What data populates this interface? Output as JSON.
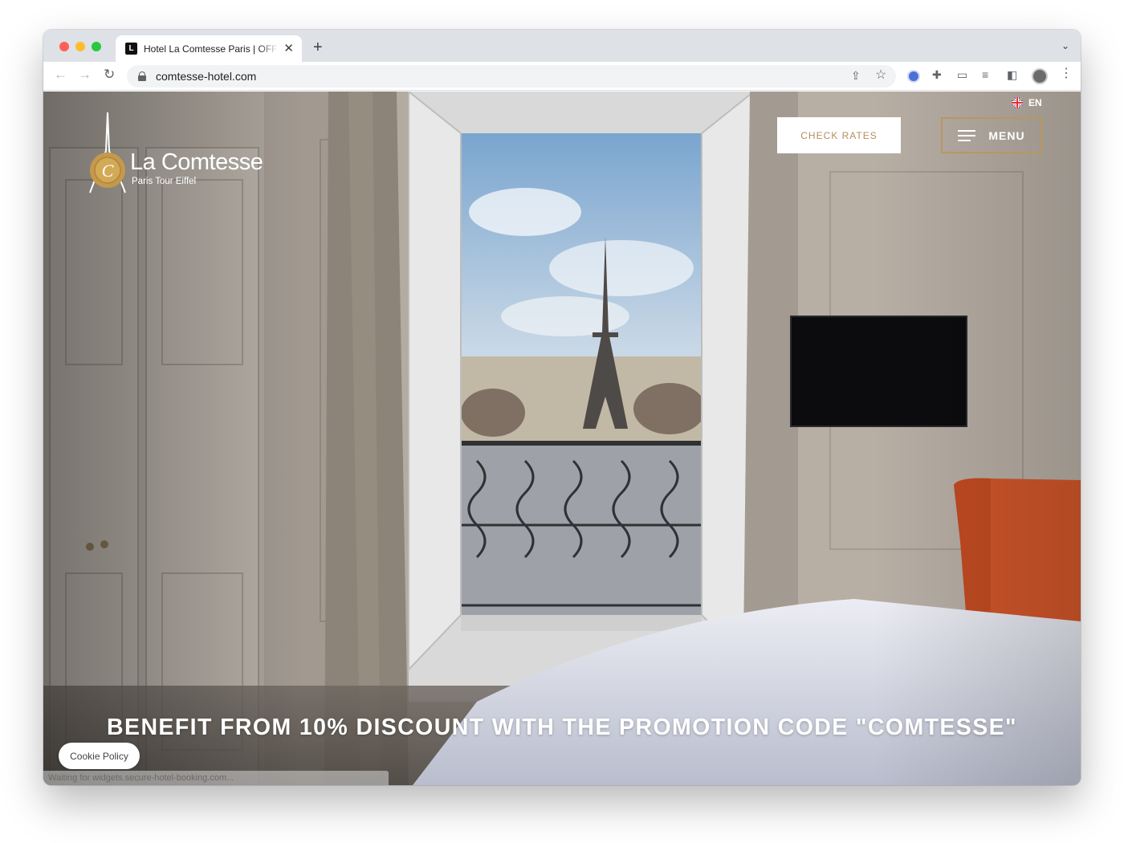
{
  "browser": {
    "tab_title": "Hotel La Comtesse Paris | OFFICIAL SITE",
    "tab_favicon": "L",
    "close_glyph": "✕",
    "new_tab_glyph": "+",
    "tab_menu_glyph": "⌄",
    "url": "comtesse-hotel.com",
    "nav": {
      "back": "←",
      "forward": "→",
      "reload": "↻"
    },
    "toolbar_icons": {
      "share": "⇪",
      "star": "☆",
      "puzzle": "✚",
      "cast": "▭",
      "media": "≡",
      "sidepanel": "◧",
      "kebab": "⋮"
    }
  },
  "site": {
    "logo_name": "La Comtesse",
    "logo_sub": "Paris Tour Eiffel",
    "logo_seal_letter": "C",
    "language": "EN",
    "check_rates": "CHECK RATES",
    "menu": "MENU",
    "promo": "BENEFIT FROM 10% DISCOUNT WITH THE PROMOTION CODE \"COMTESSE\"",
    "cookie": "Cookie Policy",
    "status": "Waiting for widgets.secure-hotel-booking.com...",
    "colors": {
      "gold": "#b8975f",
      "rates_text": "#b18f5e",
      "chair": "#d0562a",
      "wall": "#c7bfb6"
    }
  }
}
